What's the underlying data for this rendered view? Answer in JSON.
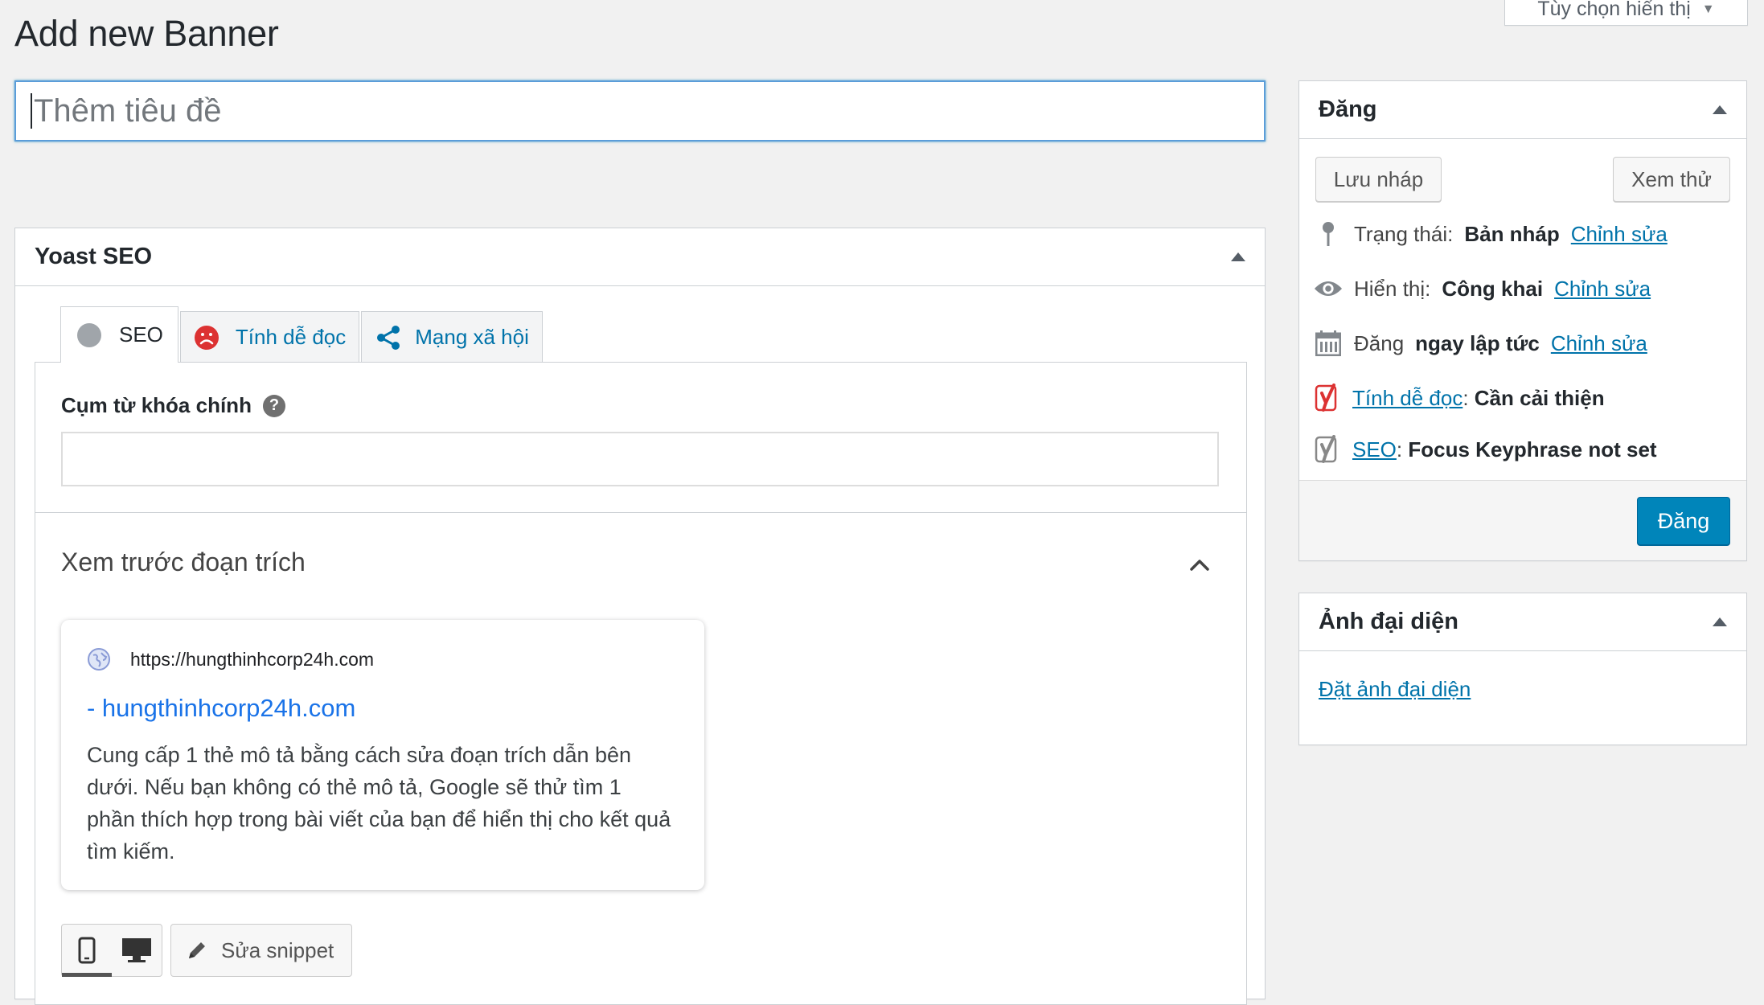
{
  "screen_options": {
    "label": "Tùy chọn hiển thị"
  },
  "page": {
    "title": "Add new Banner"
  },
  "title_field": {
    "placeholder": "Thêm tiêu đề"
  },
  "yoast": {
    "title": "Yoast SEO",
    "tabs": [
      {
        "label": "SEO",
        "icon": "grey-dot-icon"
      },
      {
        "label": "Tính dễ đọc",
        "icon": "sad-face-icon"
      },
      {
        "label": "Mạng xã hội",
        "icon": "share-icon"
      }
    ],
    "keyphrase_label": "Cụm từ khóa chính",
    "help_glyph": "?",
    "snippet_preview_title": "Xem trước đoạn trích",
    "snippet": {
      "url": "https://hungthinhcorp24h.com",
      "site_title": "- hungthinhcorp24h.com",
      "description": "Cung cấp 1 thẻ mô tả bằng cách sửa đoạn trích dẫn bên dưới. Nếu bạn không có thẻ mô tả, Google sẽ thử tìm 1 phần thích hợp trong bài viết của bạn để hiển thị cho kết quả tìm kiếm."
    },
    "edit_snippet_label": "Sửa snippet"
  },
  "publish": {
    "title": "Đăng",
    "save_draft": "Lưu nháp",
    "preview": "Xem thử",
    "status_label": "Trạng thái:",
    "status_value": "Bản nháp",
    "visibility_label": "Hiển thị:",
    "visibility_value": "Công khai",
    "schedule_label": "Đăng",
    "schedule_value": "ngay lập tức",
    "edit_link": "Chỉnh sửa",
    "readability_link": "Tính dễ đọc",
    "readability_value": "Cần cải thiện",
    "seo_link": "SEO",
    "seo_value": "Focus Keyphrase not set",
    "publish_button": "Đăng"
  },
  "featured": {
    "title": "Ảnh đại diện",
    "set_link": "Đặt ảnh đại diện"
  },
  "colors": {
    "primary": "#0085ba",
    "link": "#0073aa",
    "snippet_title": "#1a73e8",
    "bad": "#dc3232"
  }
}
